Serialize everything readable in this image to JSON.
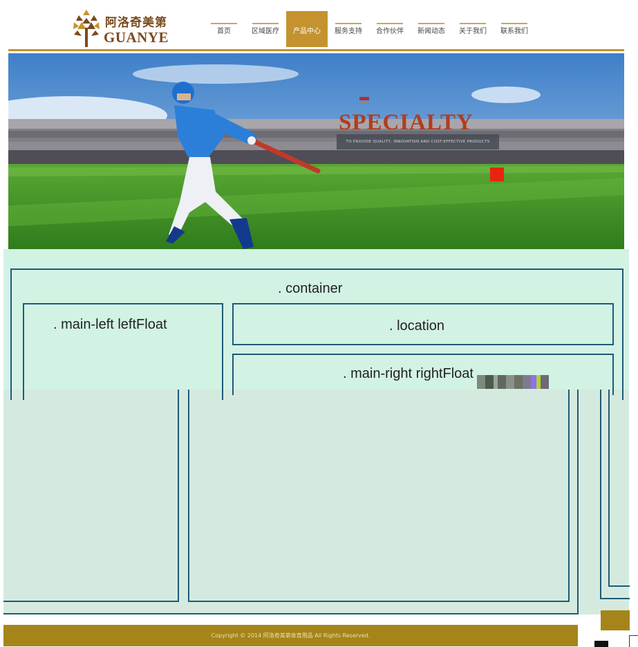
{
  "header": {
    "logo_cn": "阿洛奇美第",
    "logo_en": "GUANYE"
  },
  "nav": {
    "items": [
      {
        "label": "首页",
        "active": false
      },
      {
        "label": "区域医疗",
        "active": false
      },
      {
        "label": "产品中心",
        "active": true
      },
      {
        "label": "服务支持",
        "active": false
      },
      {
        "label": "合作伙伴",
        "active": false
      },
      {
        "label": "新闻动态",
        "active": false
      },
      {
        "label": "关于我们",
        "active": false
      },
      {
        "label": "联系我们",
        "active": false
      }
    ]
  },
  "banner": {
    "title": "SPECIALTY",
    "subtitle": "TO PROVIDE QUALITY, INNOVATION AND COST-EFFECTIVE PRODUCTS"
  },
  "layout": {
    "container_label": ". container",
    "main_left_label": ". main-left leftFloat",
    "location_label": ". location",
    "main_right_label": ". main-right rightFloat"
  },
  "footer": {
    "copyright": "Copyright © 2014 阿洛奇美第体育用品 All Rights Reserved."
  },
  "colors": {
    "accent": "#c4932f",
    "footer": "#a5851a",
    "debug_bg": "#d2f2e4",
    "debug_border": "#1e5a78",
    "banner_title": "#b23c1e"
  }
}
